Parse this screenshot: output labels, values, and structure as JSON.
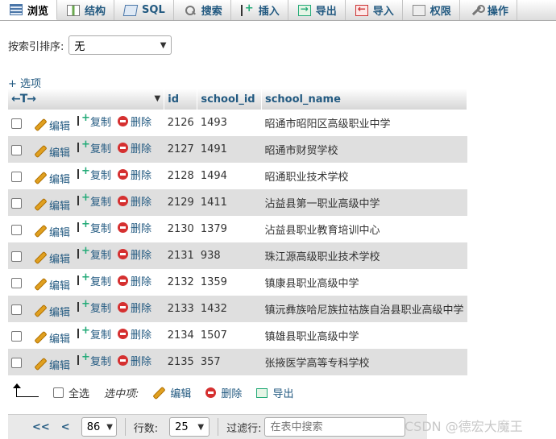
{
  "tabs": [
    {
      "label": "浏览",
      "icon": "browse-icon",
      "active": true
    },
    {
      "label": "结构",
      "icon": "structure-icon"
    },
    {
      "label": "SQL",
      "icon": "sql-icon"
    },
    {
      "label": "搜索",
      "icon": "search-icon"
    },
    {
      "label": "插入",
      "icon": "insert-icon"
    },
    {
      "label": "导出",
      "icon": "export-icon"
    },
    {
      "label": "导入",
      "icon": "import-icon"
    },
    {
      "label": "权限",
      "icon": "privileges-icon"
    },
    {
      "label": "操作",
      "icon": "operations-icon"
    }
  ],
  "sort": {
    "label": "按索引排序:",
    "value": "无"
  },
  "options_link": "+ 选项",
  "table": {
    "nav_arrows": "←T→",
    "columns": [
      "id",
      "school_id",
      "school_name"
    ],
    "action_labels": {
      "edit": "编辑",
      "copy": "复制",
      "delete": "删除"
    },
    "rows": [
      {
        "id": "2126",
        "school_id": "1493",
        "school_name": "昭通市昭阳区高级职业中学"
      },
      {
        "id": "2127",
        "school_id": "1491",
        "school_name": "昭通市财贸学校"
      },
      {
        "id": "2128",
        "school_id": "1494",
        "school_name": "昭通职业技术学校"
      },
      {
        "id": "2129",
        "school_id": "1411",
        "school_name": "沾益县第一职业高级中学"
      },
      {
        "id": "2130",
        "school_id": "1379",
        "school_name": "沾益县职业教育培训中心"
      },
      {
        "id": "2131",
        "school_id": "938",
        "school_name": "珠江源高级职业技术学校"
      },
      {
        "id": "2132",
        "school_id": "1359",
        "school_name": "镇康县职业高级中学"
      },
      {
        "id": "2133",
        "school_id": "1432",
        "school_name": "镇沅彝族哈尼族拉祜族自治县职业高级中学"
      },
      {
        "id": "2134",
        "school_id": "1507",
        "school_name": "镇雄县职业高级中学"
      },
      {
        "id": "2135",
        "school_id": "357",
        "school_name": "张掖医学高等专科学校"
      }
    ]
  },
  "bulk": {
    "select_all": "全选",
    "selected_label": "选中项:",
    "edit": "编辑",
    "delete": "删除",
    "export": "导出"
  },
  "pager": {
    "first": "<<",
    "prev": "<",
    "page": "86",
    "rows_label": "行数:",
    "rows": "25",
    "filter_label": "过滤行:",
    "filter_placeholder": "在表中搜索"
  },
  "watermark": "CSDN @德宏大魔王"
}
